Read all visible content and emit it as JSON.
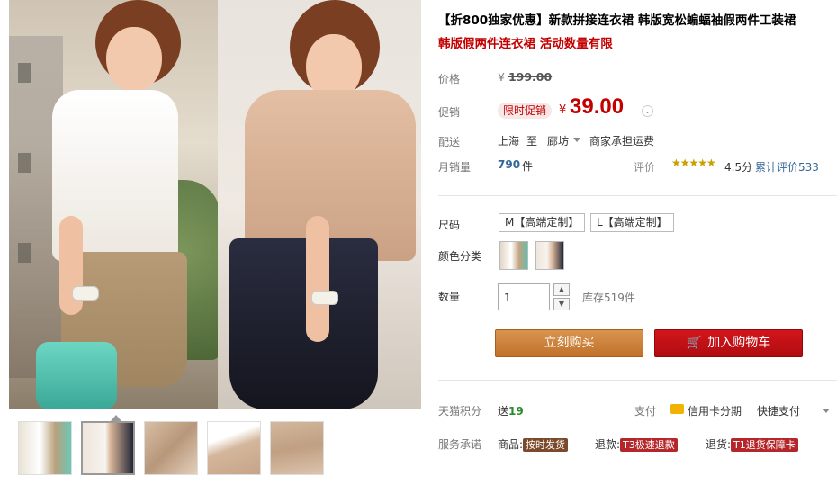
{
  "product": {
    "title": "【折800独家优惠】新款拼接连衣裙 韩版宽松蝙蝠袖假两件工装裙",
    "subtitle": "韩版假两件连衣裙 活动数量有限"
  },
  "price": {
    "label": "价格",
    "currency": "¥",
    "original": "199.00",
    "promo_label": "促销",
    "promo_badge": "限时促销",
    "promo_price": "39.00"
  },
  "shipping": {
    "label": "配送",
    "from": "上海",
    "to_word": "至",
    "to": "廊坊",
    "fee": "商家承担运费"
  },
  "sales": {
    "label": "月销量",
    "count": "790",
    "unit": "件",
    "rating_label": "评价",
    "stars": "★★★★★",
    "score": "4.5分",
    "reviews": "累计评价533"
  },
  "options": {
    "size_label": "尺码",
    "sizes": [
      "M【高端定制】",
      "L【高端定制】"
    ],
    "color_label": "颜色分类"
  },
  "quantity": {
    "label": "数量",
    "value": "1",
    "stock": "库存519件"
  },
  "actions": {
    "buy": "立刻购买",
    "cart": "加入购物车"
  },
  "points": {
    "label": "天猫积分",
    "prefix": "送",
    "value": "19"
  },
  "payment": {
    "label": "支付",
    "card": "信用卡分期",
    "quick": "快捷支付"
  },
  "service": {
    "label": "服务承诺",
    "goods_label": "商品:",
    "goods_tag": "按时发货",
    "refund_label": "退款:",
    "refund_tag": "T3极速退款",
    "return_label": "退货:",
    "return_tag": "T1退货保障卡"
  },
  "colors": {
    "accent_red": "#c40000",
    "buy_orange": "#c0712a",
    "cart_red": "#b00c10",
    "link_blue": "#336699"
  }
}
